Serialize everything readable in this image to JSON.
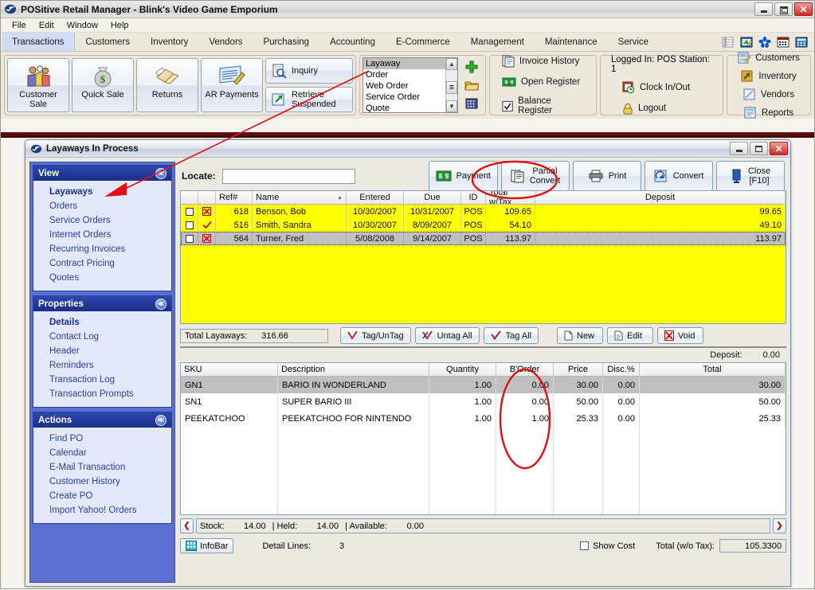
{
  "app": {
    "title": "POSitive Retail Manager - Blink's Video Game Emporium",
    "logo_icon": "app-logo-icon",
    "window_buttons": {
      "minimize": "minimize-icon",
      "restore": "restore-icon",
      "close": "close-icon"
    }
  },
  "menubar": {
    "items": [
      "File",
      "Edit",
      "Window",
      "Help"
    ]
  },
  "tabs": {
    "items": [
      "Transactions",
      "Customers",
      "Inventory",
      "Vendors",
      "Purchasing",
      "Accounting",
      "E-Commerce",
      "Management",
      "Maintenance",
      "Service"
    ],
    "active": "Transactions",
    "quick_icons": [
      "list-icon",
      "note-edit-icon",
      "asterisk-icon",
      "calendar-icon",
      "calculator-icon"
    ]
  },
  "toolbar": {
    "big_buttons": [
      {
        "label1": "Customer",
        "label2": "Sale",
        "icon": "people-icon"
      },
      {
        "label1": "Quick Sale",
        "label2": "",
        "icon": "moneybag-icon"
      },
      {
        "label1": "Returns",
        "label2": "",
        "icon": "returns-icon"
      },
      {
        "label1": "AR Payments",
        "label2": "",
        "icon": "ar-payments-icon"
      }
    ],
    "wide_buttons": [
      {
        "label1": "Inquiry",
        "label2": "",
        "icon": "inquiry-icon"
      },
      {
        "label1": "Retrieve",
        "label2": "Suspended",
        "icon": "retrieve-icon"
      }
    ],
    "doctype_list": {
      "items": [
        "Layaway",
        "Order",
        "Web Order",
        "Service Order",
        "Quote"
      ],
      "selected": "Layaway"
    },
    "doctype_actions": [
      "plus-icon",
      "folder-open-icon",
      "grid-icon"
    ],
    "links": [
      {
        "label": "Invoice History",
        "icon": "invoice-history-icon"
      },
      {
        "label": "Open Register",
        "icon": "open-register-icon"
      },
      {
        "label": "Balance Register",
        "icon": "balance-register-icon"
      }
    ],
    "status": {
      "logged_in": "Logged In: POS Station:  1",
      "clock": {
        "label": "Clock In/Out",
        "icon": "clock-icon"
      },
      "logout": {
        "label": "Logout",
        "icon": "lock-icon"
      }
    },
    "right_links": [
      {
        "label": "Customers",
        "icon": "customers-icon"
      },
      {
        "label": "Inventory",
        "icon": "inventory-icon"
      },
      {
        "label": "Vendors",
        "icon": "vendors-icon"
      },
      {
        "label": "Reports",
        "icon": "reports-icon"
      }
    ]
  },
  "inner_window": {
    "title": "Layaways In Process",
    "logo_icon": "app-logo-icon",
    "window_buttons": {
      "minimize": "minimize-icon",
      "maximize": "maximize-icon",
      "close": "close-icon"
    }
  },
  "sidebar": {
    "panels": [
      {
        "title": "View",
        "collapse_icon": "chevron-up-icon",
        "items": [
          {
            "label": "Layaways",
            "current": true
          },
          {
            "label": "Orders",
            "current": false
          },
          {
            "label": "Service Orders",
            "current": false
          },
          {
            "label": "Internet Orders",
            "current": false
          },
          {
            "label": "Recurring Invoices",
            "current": false
          },
          {
            "label": "Contract Pricing",
            "current": false
          },
          {
            "label": "Quotes",
            "current": false
          }
        ]
      },
      {
        "title": "Properties",
        "collapse_icon": "chevron-up-icon",
        "items": [
          {
            "label": "Details",
            "current": true
          },
          {
            "label": "Contact Log",
            "current": false
          },
          {
            "label": "Header",
            "current": false
          },
          {
            "label": "Reminders",
            "current": false
          },
          {
            "label": "Transaction Log",
            "current": false
          },
          {
            "label": "Transaction Prompts",
            "current": false
          }
        ]
      },
      {
        "title": "Actions",
        "collapse_icon": "chevron-up-icon",
        "items": [
          {
            "label": "Find PO",
            "current": false
          },
          {
            "label": "Calendar",
            "current": false
          },
          {
            "label": "E-Mail Transaction",
            "current": false
          },
          {
            "label": "Customer History",
            "current": false
          },
          {
            "label": "Create PO",
            "current": false
          },
          {
            "label": "Import Yahoo! Orders",
            "current": false
          }
        ]
      }
    ]
  },
  "main": {
    "locate": {
      "label": "Locate:",
      "value": "",
      "placeholder": ""
    },
    "action_buttons": [
      {
        "label1": "Payment",
        "label2": "",
        "icon": "money-icon",
        "name": "payment-button"
      },
      {
        "label1": "Partial",
        "label2": "Convert",
        "icon": "partial-convert-icon",
        "name": "partial-convert-button"
      },
      {
        "label1": "Print",
        "label2": "",
        "icon": "printer-icon",
        "name": "print-button"
      },
      {
        "label1": "Convert",
        "label2": "",
        "icon": "convert-icon",
        "name": "convert-button"
      },
      {
        "label1": "Close",
        "label2": "[F10]",
        "icon": "exit-door-icon",
        "name": "close-button"
      }
    ],
    "layaway_grid": {
      "columns": [
        "",
        "",
        "Ref#",
        "Name",
        "Entered",
        "Due",
        "ID",
        "Total w/Tax",
        "Deposit"
      ],
      "sort_column": "Name",
      "sort_icon": "sort-asc-icon",
      "rows": [
        {
          "checked": false,
          "flag_icon": "red-x-box-icon",
          "ref": "618",
          "name": "Benson, Bob",
          "entered": "10/30/2007",
          "due": "10/31/2007",
          "id": "POS",
          "total": "109.65",
          "deposit": "99.65",
          "selected": false
        },
        {
          "checked": false,
          "flag_icon": "red-check-icon",
          "ref": "516",
          "name": "Smith, Sandra",
          "entered": "10/30/2007",
          "due": "8/09/2007",
          "id": "POS",
          "total": "54.10",
          "deposit": "49.10",
          "selected": false
        },
        {
          "checked": false,
          "flag_icon": "red-x-box-icon",
          "ref": "564",
          "name": "Turner, Fred",
          "entered": "5/08/2008",
          "due": "9/14/2007",
          "id": "POS",
          "total": "113.97",
          "deposit": "113.97",
          "selected": true
        }
      ]
    },
    "totals": {
      "label": "Total Layaways:",
      "value": "316.66"
    },
    "tag_buttons": [
      {
        "label": "Tag/UnTag",
        "icon": "tag-untag-icon"
      },
      {
        "label": "Untag All",
        "icon": "untag-all-icon"
      },
      {
        "label": "Tag All",
        "icon": "tag-all-icon"
      }
    ],
    "record_buttons": [
      {
        "label": "New",
        "icon": "new-doc-icon"
      },
      {
        "label": "Edit",
        "icon": "edit-doc-icon"
      },
      {
        "label": "Void",
        "icon": "void-icon"
      }
    ],
    "deposit_line": {
      "label": "Deposit:",
      "value": "0.00"
    },
    "detail_grid": {
      "columns": [
        "SKU",
        "Description",
        "Quantity",
        "B'Order",
        "Price",
        "Disc.%",
        "Total"
      ],
      "rows": [
        {
          "sku": "GN1",
          "description": "BARIO IN WONDERLAND",
          "quantity": "1.00",
          "border": "0.00",
          "price": "30.00",
          "disc": "0.00",
          "total": "30.00",
          "selected": true
        },
        {
          "sku": "SN1",
          "description": "SUPER BARIO III",
          "quantity": "1.00",
          "border": "0.00",
          "price": "50.00",
          "disc": "0.00",
          "total": "50.00",
          "selected": false
        },
        {
          "sku": "PEEKATCHOO",
          "description": "PEEKATCHOO FOR NINTENDO",
          "quantity": "1.00",
          "border": "1.00",
          "price": "25.33",
          "disc": "0.00",
          "total": "25.33",
          "selected": false
        }
      ]
    },
    "stock_bar": {
      "prev_icon": "prev-arrow-icon",
      "next_icon": "next-arrow-icon",
      "stock_label": "Stock:",
      "stock_value": "14.00",
      "held_label": "| Held:",
      "held_value": "14.00",
      "available_label": "| Available:",
      "available_value": "0.00"
    },
    "footer": {
      "infobar_label": "InfoBar",
      "infobar_icon": "infobar-icon",
      "detail_lines_label": "Detail Lines:",
      "detail_lines_value": "3",
      "show_cost_label": "Show Cost",
      "show_cost_checked": false,
      "total_label": "Total (w/o Tax):",
      "total_value": "105.3300"
    }
  },
  "annotations": {
    "arrow_to_layaways": "red-arrow-annotation",
    "ellipse_partial_convert": "red-ellipse-annotation",
    "ellipse_border_column": "red-ellipse-annotation",
    "color": "#e01010"
  }
}
